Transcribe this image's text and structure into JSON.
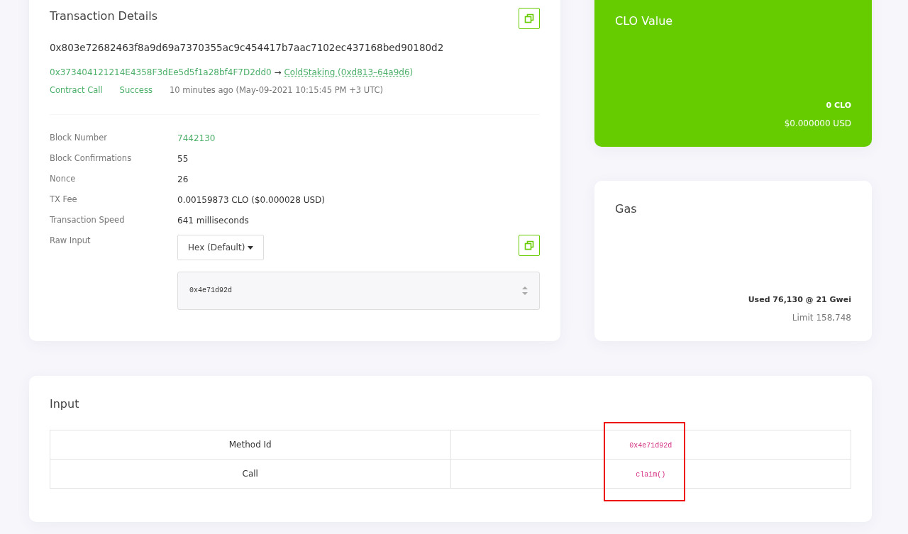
{
  "details": {
    "title": "Transaction Details",
    "hash": "0x803e72682463f8a9d69a7370355ac9c454417b7aac7102ec437168bed90180d2",
    "from": "0x373404121214E4358F3dEe5d5f1a28bf4F7D2dd0",
    "arrow": "→",
    "to": "ColdStaking (0xd813–64a9d6)",
    "type": "Contract Call",
    "status": "Success",
    "time": "10 minutes ago (May-09-2021 10:15:45 PM +3 UTC)",
    "rows": [
      {
        "label": "Block Number",
        "value": "7442130",
        "kind": "link"
      },
      {
        "label": "Block Confirmations",
        "value": "55",
        "kind": "text"
      },
      {
        "label": "Nonce",
        "value": "26",
        "kind": "text"
      },
      {
        "label": "TX Fee",
        "value": "0.00159873 CLO ($0.000028 USD)",
        "kind": "text"
      },
      {
        "label": "Transaction Speed",
        "value": "641 milliseconds",
        "kind": "text"
      }
    ],
    "raw_input": {
      "label": "Raw Input",
      "format": "Hex (Default)",
      "value": "0x4e71d92d"
    }
  },
  "value_card": {
    "title": "CLO Value",
    "amount": "0 CLO",
    "usd": "$0.000000 USD"
  },
  "gas_card": {
    "title": "Gas",
    "used": "Used 76,130 @ 21 Gwei",
    "limit": "Limit 158,748"
  },
  "input": {
    "title": "Input",
    "highlight_values": true,
    "rows": [
      {
        "name": "Method Id",
        "value": "0x4e71d92d"
      },
      {
        "name": "Call",
        "value": "claim()"
      }
    ]
  }
}
